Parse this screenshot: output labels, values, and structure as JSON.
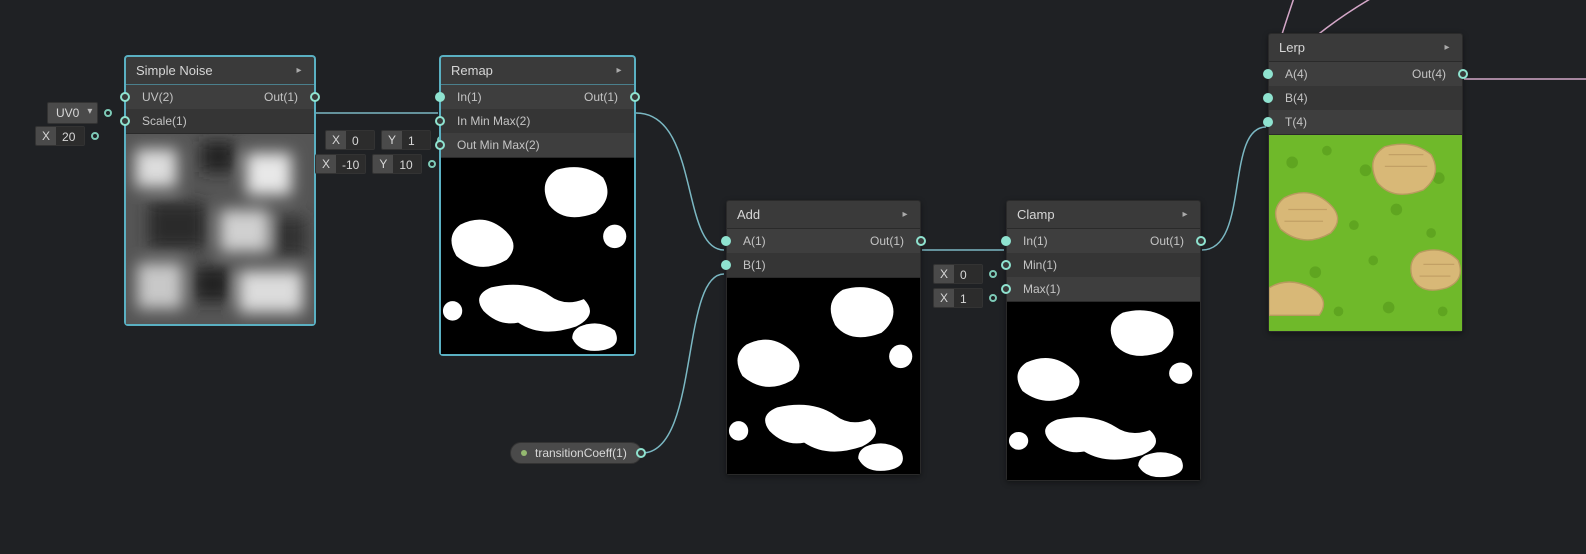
{
  "nodes": {
    "simpleNoise": {
      "title": "Simple Noise",
      "inputs": {
        "uv": "UV(2)",
        "scale": "Scale(1)"
      },
      "outputs": {
        "out": "Out(1)"
      },
      "ext": {
        "uvDropdown": "UV0",
        "scale": {
          "label": "X",
          "value": "20"
        }
      }
    },
    "remap": {
      "title": "Remap",
      "inputs": {
        "in": "In(1)",
        "inMinMax": "In Min Max(2)",
        "outMinMax": "Out Min Max(2)"
      },
      "outputs": {
        "out": "Out(1)"
      },
      "ext": {
        "inMin": {
          "labelX": "X",
          "valX": "0",
          "labelY": "Y",
          "valY": "1"
        },
        "outMin": {
          "labelX": "X",
          "valX": "-10",
          "labelY": "Y",
          "valY": "10"
        }
      }
    },
    "add": {
      "title": "Add",
      "inputs": {
        "a": "A(1)",
        "b": "B(1)"
      },
      "outputs": {
        "out": "Out(1)"
      }
    },
    "clamp": {
      "title": "Clamp",
      "inputs": {
        "in": "In(1)",
        "min": "Min(1)",
        "max": "Max(1)"
      },
      "outputs": {
        "out": "Out(1)"
      },
      "ext": {
        "min": {
          "label": "X",
          "value": "0"
        },
        "max": {
          "label": "X",
          "value": "1"
        }
      }
    },
    "lerp": {
      "title": "Lerp",
      "inputs": {
        "a": "A(4)",
        "b": "B(4)",
        "t": "T(4)"
      },
      "outputs": {
        "out": "Out(4)"
      }
    }
  },
  "transitionCoeff": {
    "label": "transitionCoeff(1)"
  },
  "icons": {
    "collapse": "▸"
  }
}
